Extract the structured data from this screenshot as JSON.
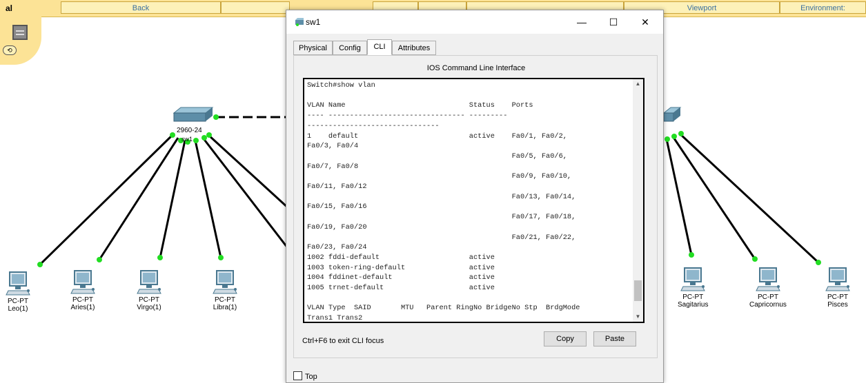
{
  "toolbar": {
    "logical_label": "al",
    "back_label": "Back",
    "viewport_label": "Viewport",
    "environment_label": "Environment:"
  },
  "devices": {
    "left_switch_label": "2960-24",
    "left_switch_name": "sw1",
    "pcs": [
      {
        "type": "PC-PT",
        "name": "Leo(1)"
      },
      {
        "type": "PC-PT",
        "name": "Aries(1)"
      },
      {
        "type": "PC-PT",
        "name": "Virgo(1)"
      },
      {
        "type": "PC-PT",
        "name": "Libra(1)"
      },
      {
        "type": "PC-PT",
        "name": "Sagitarius"
      },
      {
        "type": "PC-PT",
        "name": "Capricornus"
      },
      {
        "type": "PC-PT",
        "name": "Pisces"
      }
    ]
  },
  "window": {
    "title": "sw1",
    "minimize": "—",
    "maximize": "☐",
    "close": "✕",
    "tabs": [
      "Physical",
      "Config",
      "CLI",
      "Attributes"
    ],
    "active_tab": "CLI",
    "cli_heading": "IOS Command Line Interface",
    "cli_output": "Switch#show vlan\n\nVLAN Name                             Status    Ports\n---- -------------------------------- ---------\n-------------------------------\n1    default                          active    Fa0/1, Fa0/2,\nFa0/3, Fa0/4\n                                                Fa0/5, Fa0/6,\nFa0/7, Fa0/8\n                                                Fa0/9, Fa0/10,\nFa0/11, Fa0/12\n                                                Fa0/13, Fa0/14,\nFa0/15, Fa0/16\n                                                Fa0/17, Fa0/18,\nFa0/19, Fa0/20\n                                                Fa0/21, Fa0/22,\nFa0/23, Fa0/24\n1002 fddi-default                     active\n1003 token-ring-default               active\n1004 fddinet-default                  active\n1005 trnet-default                    active\n\nVLAN Type  SAID       MTU   Parent RingNo BridgeNo Stp  BrdgMode\nTrans1 Trans2\n---- ----- ---------- ----- ------ ------ -------- ---- --------",
    "hint": "Ctrl+F6 to exit CLI focus",
    "copy_label": "Copy",
    "paste_label": "Paste",
    "top_label": "Top"
  },
  "colors": {
    "toolbar_bg": "#fce396",
    "link_up": "#22dd22",
    "cable": "#000000"
  }
}
